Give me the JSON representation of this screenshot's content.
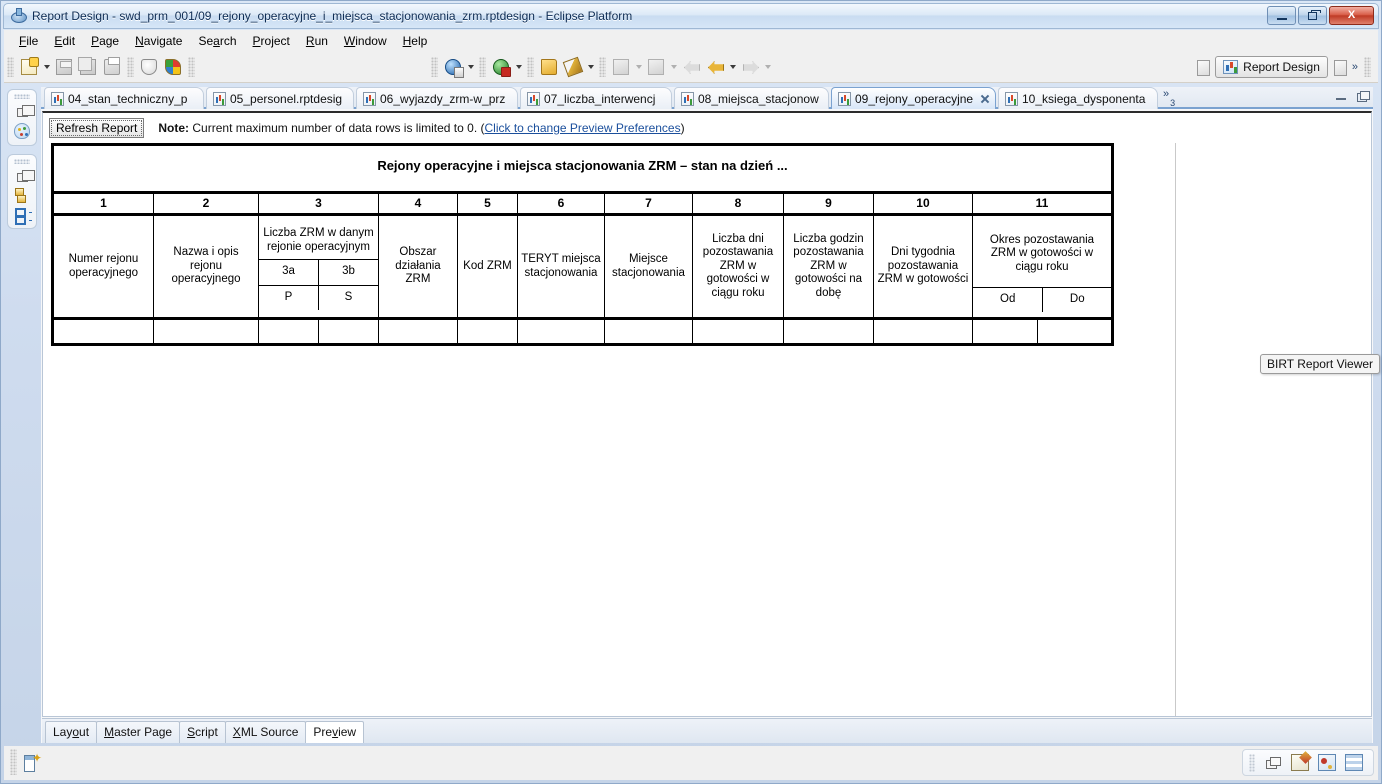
{
  "window": {
    "title": "Report Design - swd_prm_001/09_rejony_operacyjne_i_miejsca_stacjonowania_zrm.rptdesign - Eclipse Platform",
    "app_icon": "eclipse-icon",
    "minimize_label": "Minimize",
    "restore_label": "Restore",
    "close_label": "X"
  },
  "menu": {
    "items": [
      {
        "label": "File"
      },
      {
        "label": "Edit"
      },
      {
        "label": "Page"
      },
      {
        "label": "Navigate"
      },
      {
        "label": "Search"
      },
      {
        "label": "Project"
      },
      {
        "label": "Run"
      },
      {
        "label": "Window"
      },
      {
        "label": "Help"
      }
    ]
  },
  "toolbar": {
    "buttons": [
      {
        "name": "new-icon",
        "icon": "ic-doc",
        "dropdown": true,
        "enabled": true
      },
      {
        "name": "save-icon",
        "icon": "ic-save",
        "dropdown": false,
        "enabled": false
      },
      {
        "name": "save-all-icon",
        "icon": "ic-saveall",
        "dropdown": false,
        "enabled": false
      },
      {
        "name": "print-icon",
        "icon": "ic-print",
        "dropdown": false,
        "enabled": false
      },
      {
        "name": "preview-icon",
        "icon": "ic-preview",
        "dropdown": false,
        "enabled": true
      },
      {
        "name": "colors-icon",
        "icon": "ic-colors",
        "dropdown": false,
        "enabled": true
      },
      {
        "name": "web-viewer-icon",
        "icon": "ic-globe",
        "dropdown": true,
        "enabled": true
      },
      {
        "name": "run-icon",
        "icon": "ic-run",
        "dropdown": true,
        "enabled": true
      },
      {
        "name": "open-resource-icon",
        "icon": "ic-folder",
        "dropdown": false,
        "enabled": true
      },
      {
        "name": "marker-icon",
        "icon": "ic-pen",
        "dropdown": true,
        "enabled": true
      },
      {
        "name": "previous-annotation-icon",
        "icon": "ic-gray",
        "dropdown": true,
        "enabled": false
      },
      {
        "name": "next-annotation-icon",
        "icon": "ic-gray",
        "dropdown": true,
        "enabled": false
      },
      {
        "name": "last-edit-icon",
        "icon": "arr-left-dim",
        "dropdown": false,
        "enabled": false
      },
      {
        "name": "back-icon",
        "icon": "arr-left",
        "dropdown": true,
        "enabled": true
      },
      {
        "name": "forward-icon",
        "icon": "arr-right-dim",
        "dropdown": true,
        "enabled": false
      }
    ],
    "perspective": {
      "open_perspective_label": "Open Perspective",
      "active_label": "Report Design",
      "other_label": "Other perspective",
      "overflow_label": "»"
    }
  },
  "rail": {
    "groups": [
      {
        "items": [
          {
            "name": "restore-view-icon"
          },
          {
            "name": "palette-view-icon"
          }
        ]
      },
      {
        "items": [
          {
            "name": "restore-view-icon"
          },
          {
            "name": "outline-view-icon"
          },
          {
            "name": "property-list-icon"
          }
        ]
      }
    ]
  },
  "editor_tabs": {
    "items": [
      {
        "label": "04_stan_techniczny_p",
        "active": false,
        "closable": false
      },
      {
        "label": "05_personel.rptdesig",
        "active": false,
        "closable": false
      },
      {
        "label": "06_wyjazdy_zrm-w_prz",
        "active": false,
        "closable": false
      },
      {
        "label": "07_liczba_interwencj",
        "active": false,
        "closable": false
      },
      {
        "label": "08_miejsca_stacjonow",
        "active": false,
        "closable": false
      },
      {
        "label": "09_rejony_operacyjne",
        "active": true,
        "closable": true
      },
      {
        "label": "10_ksiega_dysponenta",
        "active": false,
        "closable": false
      }
    ],
    "overflow_symbol": "»",
    "overflow_count": "3",
    "minimize_label": "Minimize",
    "maximize_label": "Maximize"
  },
  "viewer": {
    "refresh_label": "Refresh Report",
    "note_prefix": "Note:",
    "note_text": "Current maximum number of data rows is limited to 0. (",
    "note_link": "Click to change Preview Preferences",
    "note_suffix": ")",
    "tooltip": "BIRT Report Viewer"
  },
  "report": {
    "title": "Rejony operacyjne i miejsca stacjonowania ZRM – stan na dzień ...",
    "column_numbers": [
      "1",
      "2",
      "3",
      "4",
      "5",
      "6",
      "7",
      "8",
      "9",
      "10",
      "11"
    ],
    "headers": {
      "numer_rejonu": "Numer rejonu operacyjnego",
      "nazwa_opis": "Nazwa i opis rejonu operacyjnego",
      "liczba_zrm_group": "Liczba ZRM w danym rejonie operacyjnym",
      "sub_3a": "3a",
      "sub_3b": "3b",
      "sub_p": "P",
      "sub_s": "S",
      "obszar": "Obszar działania ZRM",
      "kod_zrm": "Kod ZRM",
      "teryt": "TERYT miejsca stacjonowania",
      "miejsce": "Miejsce stacjonowania",
      "liczba_dni": "Liczba dni pozostawania ZRM w gotowości w ciągu roku",
      "liczba_godzin": "Liczba godzin pozostawania ZRM w gotowości na dobę",
      "dni_tygodnia": "Dni tygodnia pozostawania ZRM w gotowości",
      "okres_group": "Okres pozostawania ZRM w gotowości w ciągu roku",
      "okres_od": "Od",
      "okres_do": "Do"
    },
    "data_rows": [
      [
        "",
        "",
        "",
        "",
        "",
        "",
        "",
        "",
        "",
        "",
        "",
        "",
        ""
      ]
    ]
  },
  "bottom_tabs": {
    "items": [
      {
        "label": "Layout",
        "active": false
      },
      {
        "label": "Master Page",
        "active": false
      },
      {
        "label": "Script",
        "active": false
      },
      {
        "label": "XML Source",
        "active": false
      },
      {
        "label": "Preview",
        "active": true
      }
    ]
  },
  "statusbar": {
    "left_icon": "selection-mode-icon",
    "right_icons": [
      {
        "name": "restore-trim-icon"
      },
      {
        "name": "edit-report-icon"
      },
      {
        "name": "report-design-icon"
      },
      {
        "name": "data-grid-icon"
      }
    ]
  }
}
